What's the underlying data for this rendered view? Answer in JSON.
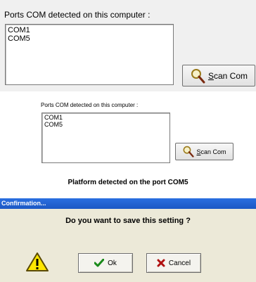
{
  "top": {
    "label": "Ports COM detected on this computer :",
    "ports": [
      "COM1",
      "COM5"
    ],
    "scan_button": {
      "underlined": "S",
      "rest": "can Com"
    }
  },
  "middle": {
    "label": "Ports COM detected on this computer :",
    "ports": [
      "COM1",
      "COM5"
    ],
    "scan_button": {
      "underlined": "S",
      "rest": "can Com"
    },
    "platform_message": "Platform detected on the port COM5"
  },
  "dialog": {
    "title": "Confirmation...",
    "message": "Do you want to save this setting ?",
    "ok": {
      "underlined": "O",
      "rest": "k"
    },
    "cancel": {
      "underlined": "C",
      "rest": "ancel"
    }
  },
  "colors": {
    "titlebar": "#1c58c4",
    "ok_check": "#1a8a1a",
    "cancel_x": "#b01010",
    "warning": "#ffe600"
  },
  "icons": [
    "magnifier-icon",
    "warning-icon",
    "check-icon",
    "x-icon"
  ]
}
